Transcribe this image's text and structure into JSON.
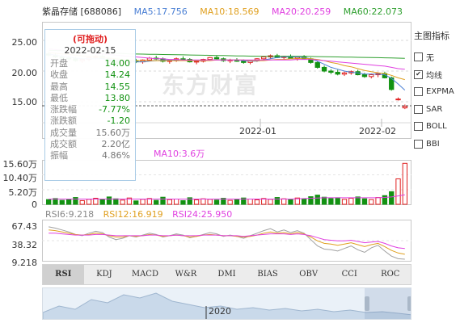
{
  "header": {
    "stock": "紫晶存储 [688086]",
    "ma5": "MA5:17.756",
    "ma10": "MA10:18.569",
    "ma20": "MA20:20.259",
    "ma60": "MA60:22.073",
    "colors": {
      "ma5": "#4a7fd4",
      "ma10": "#e0a020",
      "ma20": "#e040e0",
      "ma60": "#30a030"
    }
  },
  "price_axis": [
    "25.00",
    "20.00",
    "15.00"
  ],
  "time_axis": [
    "2022-01",
    "2022-02"
  ],
  "vol_header": "MA10:3.6万",
  "vol_axis": [
    "15.60万",
    "10.40万",
    "5.20万",
    "0"
  ],
  "rsi_header": {
    "rsi6": "RSI6:9.218",
    "rsi12": "RSI12:16.919",
    "rsi24": "RSI24:25.950"
  },
  "rsi_axis": [
    "67.43",
    "38.32",
    "9.218"
  ],
  "tooltip": {
    "title": "(可拖动)",
    "date": "2022-02-15",
    "rows": [
      {
        "label": "开盘",
        "value": "14.00"
      },
      {
        "label": "收盘",
        "value": "14.24"
      },
      {
        "label": "最高",
        "value": "14.55"
      },
      {
        "label": "最低",
        "value": "13.80"
      },
      {
        "label": "涨跌幅",
        "value": "-7.77%"
      },
      {
        "label": "涨跌额",
        "value": "-1.20"
      },
      {
        "label": "成交量",
        "value": "15.60万"
      },
      {
        "label": "成交额",
        "value": "2.20亿"
      },
      {
        "label": "振幅",
        "value": "4.86%"
      }
    ]
  },
  "sidebar": {
    "title": "主图指标",
    "options": [
      {
        "label": "无",
        "checked": false
      },
      {
        "label": "均线",
        "checked": true
      },
      {
        "label": "EXPMA",
        "checked": false
      },
      {
        "label": "SAR",
        "checked": false
      },
      {
        "label": "BOLL",
        "checked": false
      },
      {
        "label": "BBI",
        "checked": false
      }
    ]
  },
  "tabs": [
    "RSI",
    "KDJ",
    "MACD",
    "W&R",
    "DMI",
    "BIAS",
    "OBV",
    "CCI",
    "ROC"
  ],
  "active_tab": "RSI",
  "watermark": "东方财富",
  "navigator_label": "2020",
  "chart_data": [
    {
      "type": "candlestick",
      "title": "紫晶存储 [688086]",
      "x_ticks": [
        "2022-01",
        "2022-02"
      ],
      "ylim": [
        12.5,
        27.5
      ],
      "y_ticks": [
        25,
        20,
        15
      ],
      "series": [
        {
          "name": "MA5",
          "color": "#4a7fd4"
        },
        {
          "name": "MA10",
          "color": "#e0a020"
        },
        {
          "name": "MA20",
          "color": "#e040e0"
        },
        {
          "name": "MA60",
          "color": "#30a030"
        }
      ],
      "candles": [
        [
          22.8,
          23.2,
          22.4,
          22.6
        ],
        [
          22.6,
          22.9,
          22.1,
          22.3
        ],
        [
          22.3,
          22.6,
          21.8,
          22.1
        ],
        [
          22.1,
          22.5,
          21.7,
          22.0
        ],
        [
          22.0,
          22.3,
          21.5,
          21.7
        ],
        [
          21.7,
          22.1,
          21.3,
          21.9
        ],
        [
          21.9,
          22.4,
          21.6,
          22.2
        ],
        [
          22.2,
          22.6,
          21.9,
          22.4
        ],
        [
          22.4,
          22.8,
          22.0,
          22.1
        ],
        [
          22.1,
          22.3,
          21.4,
          21.6
        ],
        [
          21.6,
          21.8,
          21.0,
          21.2
        ],
        [
          21.2,
          21.6,
          20.9,
          21.4
        ],
        [
          21.4,
          21.9,
          21.2,
          21.7
        ],
        [
          21.7,
          22.0,
          21.3,
          21.5
        ],
        [
          21.5,
          21.9,
          21.2,
          21.8
        ],
        [
          21.8,
          22.3,
          21.6,
          22.1
        ],
        [
          22.1,
          22.5,
          21.8,
          22.0
        ],
        [
          22.0,
          22.2,
          21.4,
          21.6
        ],
        [
          21.6,
          21.9,
          21.2,
          21.7
        ],
        [
          21.7,
          22.2,
          21.5,
          22.0
        ],
        [
          22.0,
          22.4,
          21.7,
          21.9
        ],
        [
          21.9,
          22.1,
          21.4,
          21.5
        ],
        [
          21.5,
          21.8,
          21.1,
          21.6
        ],
        [
          21.6,
          22.0,
          21.4,
          21.9
        ],
        [
          21.9,
          22.3,
          21.7,
          22.2
        ],
        [
          22.2,
          22.5,
          21.9,
          22.0
        ],
        [
          22.0,
          22.2,
          21.5,
          21.7
        ],
        [
          21.7,
          22.0,
          21.3,
          21.8
        ],
        [
          21.8,
          22.1,
          21.5,
          21.6
        ],
        [
          21.6,
          21.9,
          21.2,
          21.4
        ],
        [
          21.4,
          21.8,
          21.1,
          21.7
        ],
        [
          21.7,
          22.1,
          21.5,
          22.0
        ],
        [
          22.0,
          22.4,
          21.8,
          22.3
        ],
        [
          22.3,
          22.7,
          22.0,
          22.5
        ],
        [
          22.5,
          22.8,
          22.1,
          22.2
        ],
        [
          22.2,
          22.5,
          21.8,
          22.4
        ],
        [
          22.4,
          22.7,
          22.0,
          22.1
        ],
        [
          22.1,
          22.4,
          21.7,
          22.3
        ],
        [
          22.3,
          22.6,
          21.9,
          22.0
        ],
        [
          22.0,
          22.2,
          21.2,
          21.4
        ],
        [
          21.4,
          21.6,
          20.4,
          20.6
        ],
        [
          20.6,
          20.9,
          19.8,
          20.0
        ],
        [
          20.0,
          20.3,
          19.5,
          19.8
        ],
        [
          19.8,
          20.2,
          19.3,
          19.5
        ],
        [
          19.5,
          19.9,
          19.2,
          19.7
        ],
        [
          19.7,
          20.1,
          19.4,
          19.9
        ],
        [
          19.9,
          20.2,
          19.3,
          19.4
        ],
        [
          19.4,
          19.7,
          18.9,
          19.1
        ],
        [
          19.1,
          19.6,
          18.8,
          19.4
        ],
        [
          19.4,
          19.8,
          19.0,
          19.6
        ],
        [
          19.6,
          19.9,
          18.8,
          18.9
        ],
        [
          18.9,
          19.1,
          16.8,
          17.0
        ],
        [
          15.44,
          15.7,
          15.2,
          15.44
        ],
        [
          14.0,
          14.55,
          13.8,
          14.24
        ]
      ],
      "ma": {
        "ma5": [
          22.8,
          22.6,
          22.4,
          22.3,
          22.1,
          22.0,
          22.0,
          22.0,
          22.0,
          21.9,
          21.8,
          21.7,
          21.6,
          21.5,
          21.5,
          21.6,
          21.7,
          21.8,
          21.8,
          21.8,
          21.8,
          21.7,
          21.7,
          21.7,
          21.8,
          21.8,
          21.8,
          21.8,
          21.8,
          21.7,
          21.6,
          21.6,
          21.8,
          22.0,
          22.2,
          22.3,
          22.3,
          22.3,
          22.2,
          22.0,
          21.6,
          21.1,
          20.6,
          20.3,
          20.0,
          19.8,
          19.7,
          19.5,
          19.5,
          19.5,
          19.4,
          18.8,
          17.9,
          16.9
        ],
        "ma10": [
          23.0,
          22.9,
          22.8,
          22.7,
          22.6,
          22.5,
          22.4,
          22.3,
          22.2,
          22.1,
          22.0,
          21.9,
          21.8,
          21.7,
          21.7,
          21.7,
          21.7,
          21.7,
          21.7,
          21.7,
          21.7,
          21.7,
          21.7,
          21.7,
          21.7,
          21.8,
          21.8,
          21.8,
          21.8,
          21.8,
          21.7,
          21.7,
          21.7,
          21.8,
          21.9,
          21.9,
          22.0,
          22.0,
          22.1,
          22.0,
          21.9,
          21.7,
          21.4,
          21.2,
          20.9,
          20.7,
          20.4,
          20.1,
          19.9,
          19.7,
          19.6,
          19.3,
          18.9,
          18.6
        ],
        "ma20": [
          23.6,
          23.5,
          23.4,
          23.3,
          23.2,
          23.1,
          23.0,
          22.9,
          22.8,
          22.7,
          22.6,
          22.5,
          22.4,
          22.3,
          22.2,
          22.1,
          22.0,
          22.0,
          21.9,
          21.9,
          21.8,
          21.8,
          21.8,
          21.8,
          21.8,
          21.8,
          21.8,
          21.8,
          21.8,
          21.8,
          21.8,
          21.8,
          21.8,
          21.8,
          21.8,
          21.8,
          21.8,
          21.9,
          21.9,
          21.9,
          21.8,
          21.7,
          21.6,
          21.5,
          21.4,
          21.3,
          21.2,
          21.1,
          21.0,
          20.9,
          20.8,
          20.6,
          20.4,
          20.3
        ],
        "ma60": [
          23.4,
          23.35,
          23.3,
          23.25,
          23.2,
          23.15,
          23.1,
          23.05,
          23.0,
          22.95,
          22.9,
          22.85,
          22.8,
          22.78,
          22.76,
          22.74,
          22.72,
          22.7,
          22.68,
          22.66,
          22.64,
          22.62,
          22.6,
          22.58,
          22.56,
          22.54,
          22.52,
          22.5,
          22.48,
          22.46,
          22.44,
          22.42,
          22.41,
          22.4,
          22.4,
          22.4,
          22.4,
          22.4,
          22.4,
          22.38,
          22.36,
          22.34,
          22.32,
          22.3,
          22.28,
          22.26,
          22.24,
          22.22,
          22.2,
          22.18,
          22.16,
          22.13,
          22.1,
          22.07
        ]
      }
    },
    {
      "type": "bar",
      "title": "成交量",
      "ylim": [
        0,
        160000
      ],
      "values": [
        18000,
        22000,
        15000,
        20000,
        26000,
        14000,
        19000,
        23000,
        17000,
        28000,
        21000,
        16000,
        24000,
        13000,
        19000,
        22000,
        15000,
        27000,
        18000,
        20000,
        14000,
        25000,
        17000,
        21000,
        19000,
        16000,
        23000,
        15000,
        18000,
        24000,
        20000,
        17000,
        22000,
        19000,
        26000,
        21000,
        18000,
        24000,
        20000,
        29000,
        35000,
        27000,
        22000,
        25000,
        19000,
        23000,
        28000,
        21000,
        18000,
        26000,
        33000,
        48000,
        97000,
        156000
      ],
      "ma10": [
        20000,
        20000,
        20000,
        20000,
        20000,
        20000,
        20000,
        20000,
        20000,
        20000,
        20000,
        20000,
        20000,
        20000,
        20000,
        20000,
        20000,
        20000,
        20000,
        20000,
        20000,
        20000,
        20000,
        20000,
        20000,
        20000,
        20000,
        20000,
        20000,
        20000,
        20000,
        20000,
        20000,
        20000,
        20000,
        20000,
        20000,
        21000,
        22000,
        23000,
        24000,
        25000,
        25000,
        25000,
        25000,
        25000,
        25000,
        25000,
        25000,
        25000,
        26000,
        28000,
        32000,
        36000
      ]
    },
    {
      "type": "line",
      "title": "RSI",
      "ylim": [
        9.218,
        67.43
      ],
      "series": [
        {
          "name": "RSI6",
          "color": "#a0a0a0",
          "values": [
            60,
            58,
            55,
            52,
            48,
            46,
            50,
            53,
            51,
            44,
            40,
            42,
            46,
            44,
            47,
            50,
            48,
            44,
            46,
            49,
            47,
            43,
            45,
            48,
            51,
            49,
            45,
            47,
            45,
            42,
            46,
            50,
            54,
            57,
            52,
            55,
            51,
            54,
            50,
            40,
            30,
            25,
            24,
            22,
            26,
            30,
            24,
            20,
            27,
            31,
            22,
            14,
            10,
            9.218
          ]
        },
        {
          "name": "RSI12",
          "color": "#e0a020",
          "values": [
            55,
            54,
            52,
            50,
            48,
            47,
            48,
            50,
            49,
            46,
            44,
            44,
            46,
            45,
            46,
            48,
            47,
            45,
            46,
            47,
            46,
            44,
            45,
            47,
            48,
            47,
            46,
            46,
            45,
            44,
            45,
            47,
            50,
            52,
            50,
            51,
            49,
            51,
            49,
            44,
            38,
            34,
            33,
            31,
            33,
            35,
            32,
            29,
            32,
            34,
            29,
            23,
            19,
            16.919
          ]
        },
        {
          "name": "RSI24",
          "color": "#e040e0",
          "values": [
            50,
            50,
            49,
            48,
            47,
            47,
            47,
            48,
            48,
            47,
            46,
            46,
            46,
            46,
            46,
            47,
            47,
            46,
            46,
            47,
            46,
            46,
            46,
            47,
            47,
            47,
            46,
            46,
            46,
            45,
            46,
            47,
            48,
            49,
            49,
            49,
            48,
            49,
            48,
            46,
            43,
            40,
            39,
            38,
            38,
            39,
            37,
            35,
            36,
            37,
            34,
            30,
            27,
            25.95
          ]
        }
      ]
    }
  ]
}
